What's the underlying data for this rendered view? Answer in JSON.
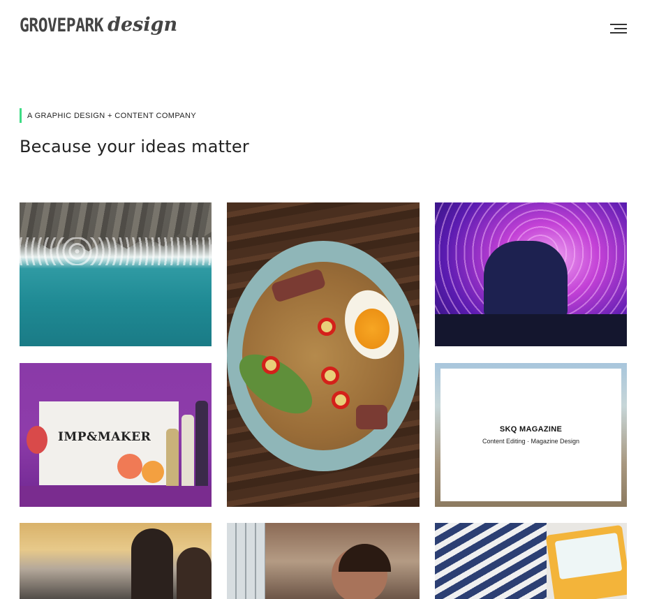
{
  "header": {
    "logo_main": "GROVEPARK",
    "logo_script": "design",
    "menu_icon": "hamburger-menu-icon"
  },
  "hero": {
    "tagline": "A GRAPHIC DESIGN + CONTENT COMPANY",
    "headline": "Because your ideas matter",
    "accent_color": "#3ddc84"
  },
  "portfolio": {
    "imp_label": "IMP&MAKER",
    "skq": {
      "title": "SKQ MAGAZINE",
      "subtitle": "Content Editing · Magazine Design"
    }
  }
}
